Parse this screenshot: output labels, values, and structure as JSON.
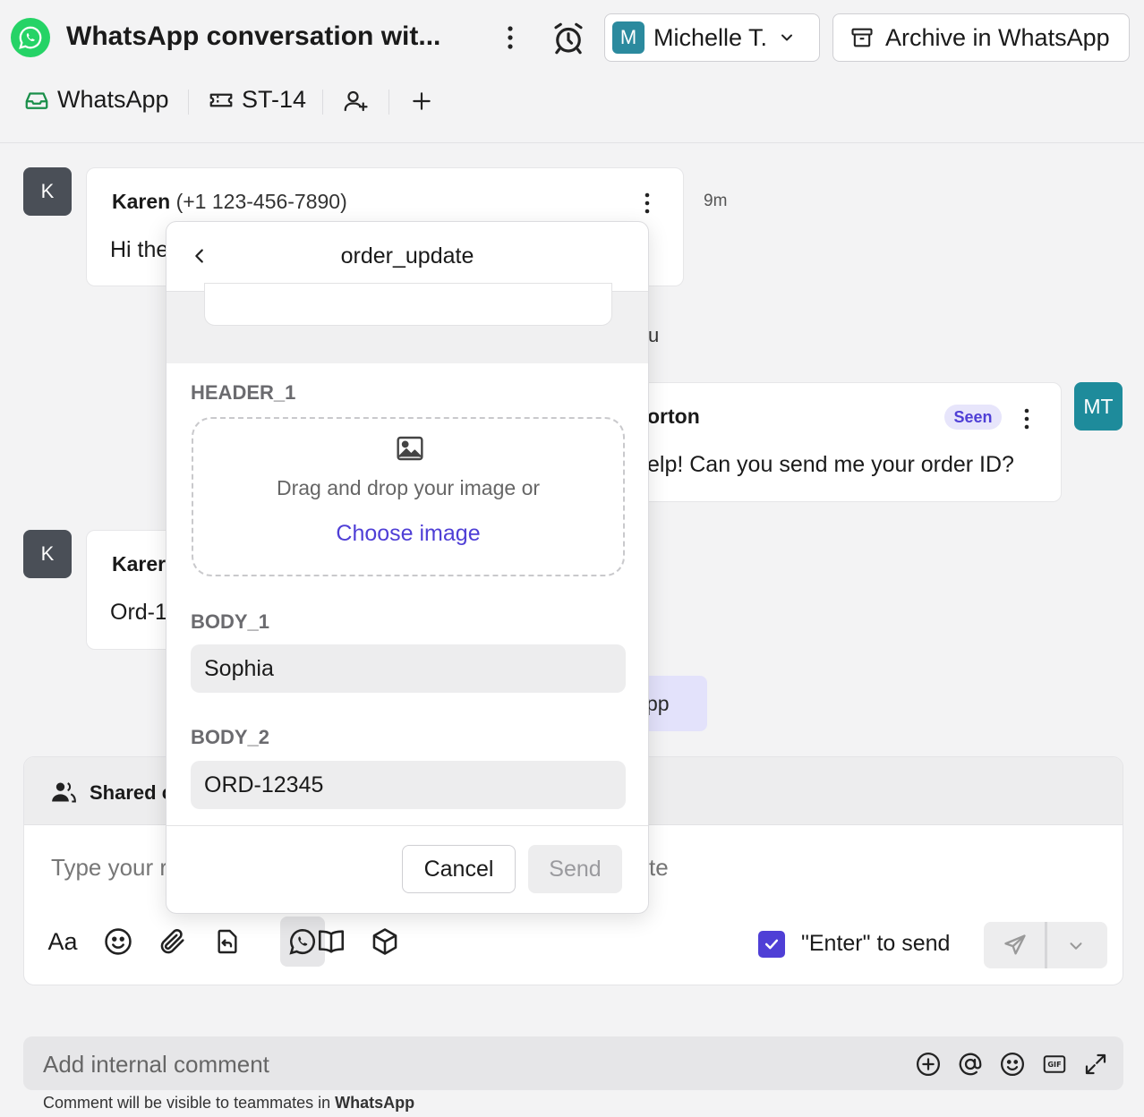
{
  "header": {
    "title": "WhatsApp conversation wit...",
    "assignee": {
      "initial": "M",
      "name": "Michelle T."
    },
    "archive_label": "Archive in WhatsApp"
  },
  "tabs": {
    "inbox_label": "WhatsApp",
    "ticket_label": "ST-14"
  },
  "messages": [
    {
      "avatar": "K",
      "sender": "Karen",
      "phone": "(+1 123-456-7890)",
      "text": "Hi the",
      "time": "9m"
    },
    {
      "fragment": "u"
    },
    {
      "avatar": "MT",
      "sender_fragment": "orton",
      "status": "Seen",
      "text_fragment": "elp! Can you send me your order ID?"
    },
    {
      "avatar": "K",
      "sender_fragment": "Karer",
      "text_fragment": "Ord-1"
    },
    {
      "fragment": "pp"
    }
  ],
  "composer": {
    "shared_label": "Shared c",
    "placeholder_left": "Type your r",
    "placeholder_right": "te",
    "font_tool": "Aa",
    "enter_to_send": "\"Enter\" to send",
    "enter_checked": true
  },
  "comment": {
    "placeholder": "Add internal comment",
    "note_prefix": "Comment will be visible to teammates in",
    "note_target": "WhatsApp"
  },
  "template_popup": {
    "title": "order_update",
    "header_field": {
      "label": "HEADER_1",
      "drop_text": "Drag and drop your image or",
      "choose_label": "Choose image"
    },
    "body_fields": [
      {
        "label": "BODY_1",
        "value": "Sophia"
      },
      {
        "label": "BODY_2",
        "value": "ORD-12345"
      }
    ],
    "cancel_label": "Cancel",
    "send_label": "Send"
  },
  "colors": {
    "accent": "#4f3fd6",
    "whatsapp": "#25d366",
    "seen_bg": "#e7e5fb"
  },
  "icons": {
    "app": "whatsapp-icon",
    "more": "kebab-icon",
    "snooze": "alarm-icon",
    "archive": "archive-icon"
  }
}
